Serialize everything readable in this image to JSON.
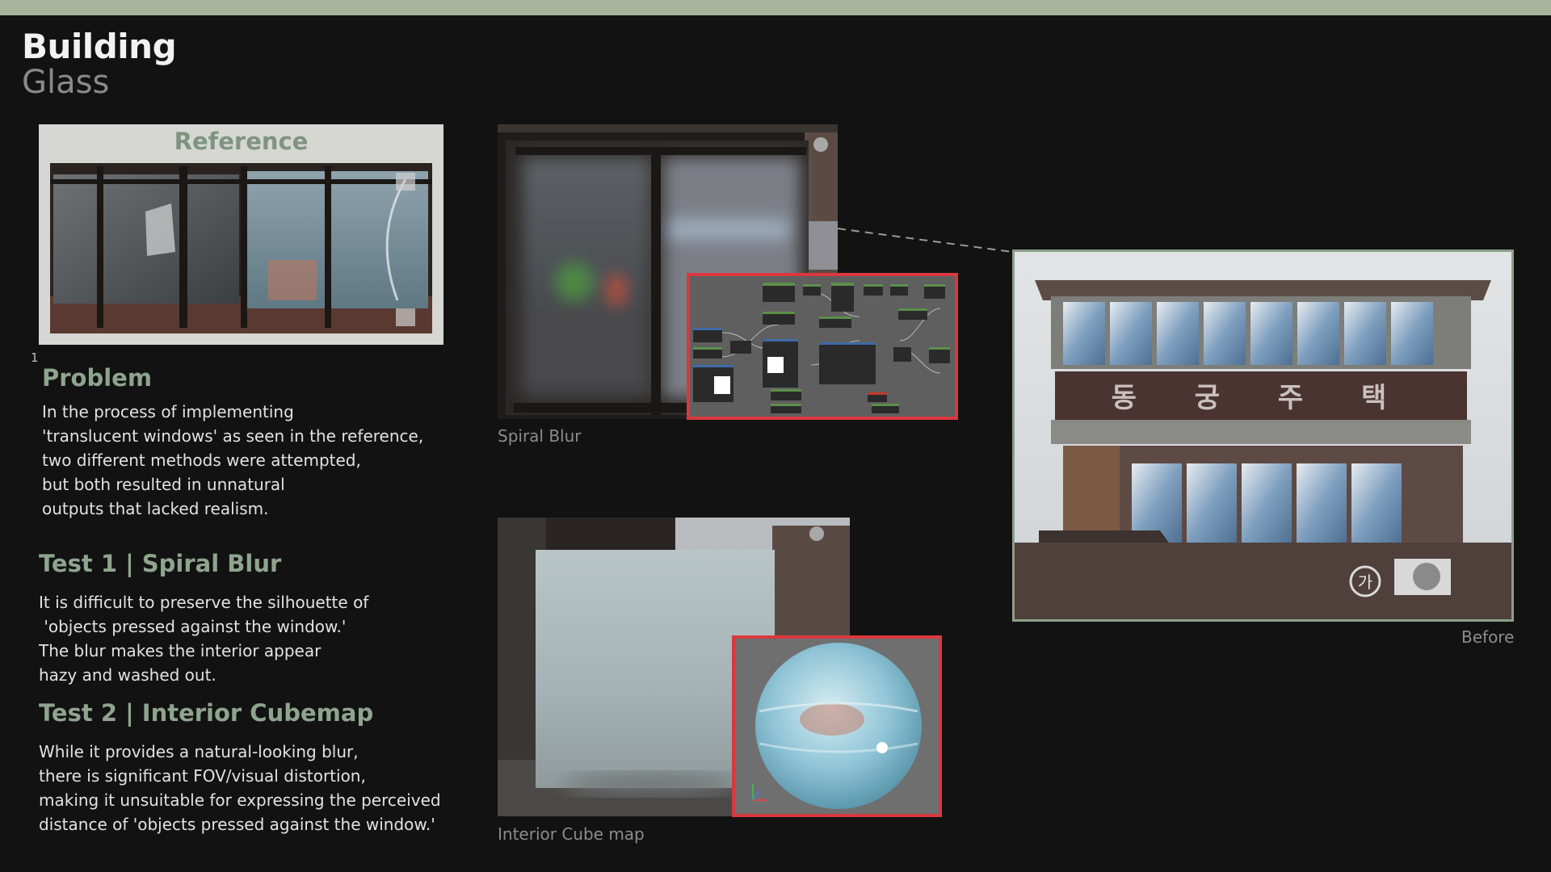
{
  "header": {
    "title": "Building",
    "subtitle": "Glass"
  },
  "reference": {
    "label": "Reference"
  },
  "footnote": "1",
  "problem": {
    "heading": "Problem",
    "lines": [
      "In the process of implementing",
      "'translucent windows' as seen in the reference,",
      "two different methods were attempted,",
      "but both resulted in unnatural",
      "outputs that lacked realism."
    ]
  },
  "test1": {
    "heading": "Test 1 | Spiral Blur",
    "lines": [
      "It is difficult to preserve the silhouette of",
      " 'objects pressed against the window.'",
      "The blur makes the interior appear",
      "hazy and washed out."
    ]
  },
  "test2": {
    "heading": "Test 2 | Interior Cubemap",
    "lines": [
      "While it provides a natural-looking blur,",
      "there is significant FOV/visual distortion,",
      "making it unsuitable for expressing the perceived",
      "distance of 'objects pressed against the window.'"
    ]
  },
  "images": {
    "spiral_caption": "Spiral Blur",
    "cubemap_caption": "Interior Cube map",
    "before_caption": "Before",
    "sign_text": "동 궁  주  택",
    "ac_sign": "가"
  },
  "colors": {
    "accent_green": "#8fa48e",
    "highlight_red": "#d9393e",
    "top_bar": "#a9b29b"
  }
}
